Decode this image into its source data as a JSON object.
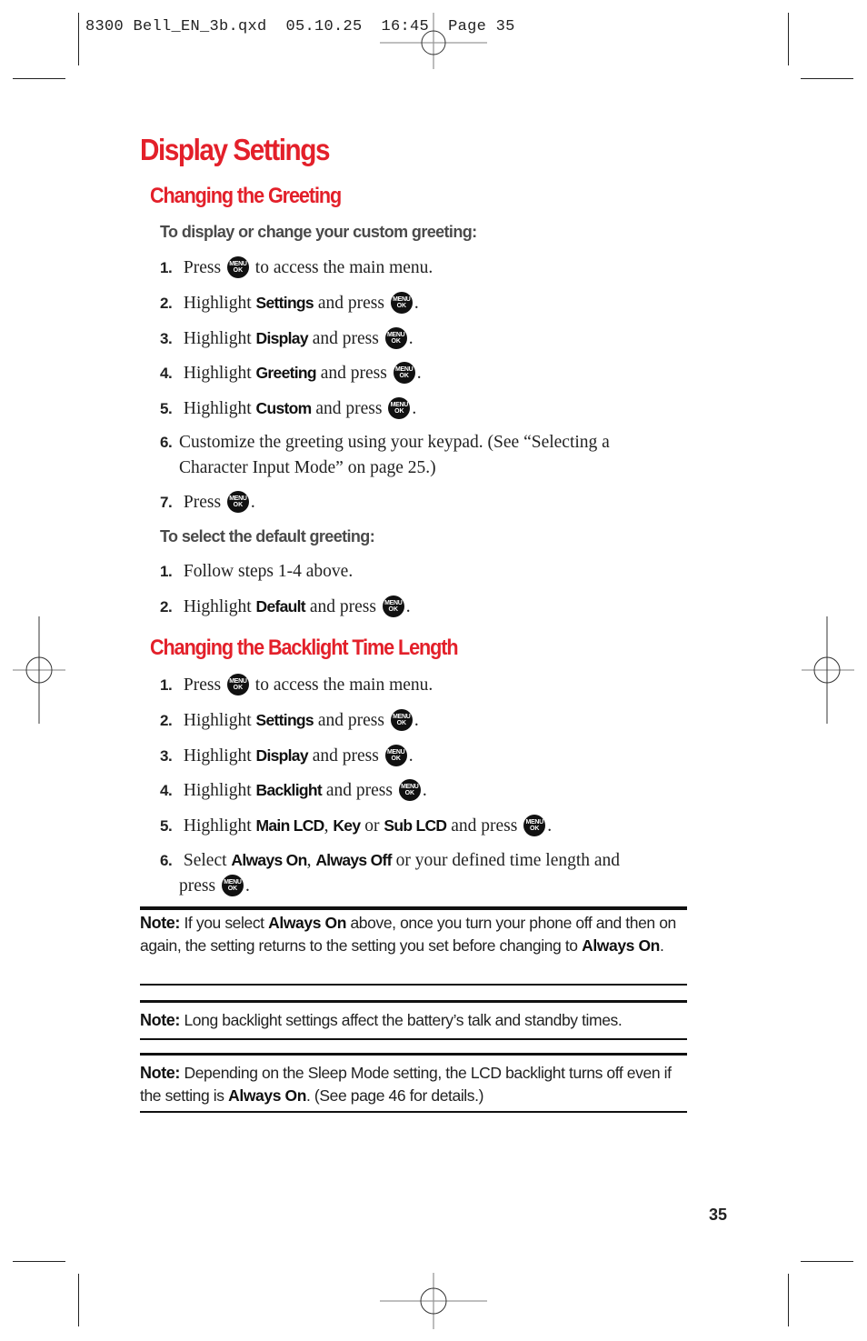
{
  "slug_line": "8300 Bell_EN_3b.qxd  05.10.25  16:45  Page 35",
  "title": "Display Settings",
  "icons": {
    "menu_ok": {
      "line1": "MENU",
      "line2": "OK",
      "name": "menu-ok-key-icon"
    }
  },
  "section1": {
    "heading": "Changing the Greeting",
    "custom": {
      "subheading": "To display or change your custom greeting:",
      "steps": [
        {
          "num": "1.",
          "pre": "Press",
          "kw": "",
          "post": "to access the main menu."
        },
        {
          "num": "2.",
          "pre": "Highlight",
          "kw": "Settings",
          "post": "and press",
          "end": "."
        },
        {
          "num": "3.",
          "pre": "Highlight",
          "kw": "Display",
          "post": "and press",
          "end": "."
        },
        {
          "num": "4.",
          "pre": "Highlight",
          "kw": "Greeting",
          "post": "and press",
          "end": "."
        },
        {
          "num": "5.",
          "pre": "Highlight",
          "kw": "Custom",
          "post": "and press",
          "end": "."
        },
        {
          "num": "6.",
          "line1": "Customize the greeting using your keypad. (See “Selecting a",
          "line2": "Character Input Mode” on page 25.)"
        },
        {
          "num": "7.",
          "pre": "Press",
          "end": "."
        }
      ]
    },
    "default": {
      "subheading": "To select the default greeting:",
      "steps": [
        {
          "num": "1.",
          "text": "Follow steps 1-4 above."
        },
        {
          "num": "2.",
          "pre": "Highlight",
          "kw": "Default",
          "post": "and press",
          "end": "."
        }
      ]
    }
  },
  "section2": {
    "heading": "Changing the Backlight Time Length",
    "steps": [
      {
        "num": "1.",
        "pre": "Press",
        "post": "to access the main menu."
      },
      {
        "num": "2.",
        "pre": "Highlight",
        "kw": "Settings",
        "post": "and press",
        "end": "."
      },
      {
        "num": "3.",
        "pre": "Highlight",
        "kw": "Display",
        "post": "and press",
        "end": "."
      },
      {
        "num": "4.",
        "pre": "Highlight",
        "kw": "Backlight",
        "post": "and press",
        "end": "."
      },
      {
        "num": "5.",
        "pre": "Highlight",
        "kw1": "Main LCD",
        "sep1": ",",
        "kw2": "Key",
        "sep2": "or",
        "kw3": "Sub LCD",
        "post": "and press",
        "end": "."
      },
      {
        "num": "6.",
        "pre": "Select",
        "kw1": "Always On",
        "sep1": ",",
        "kw2": "Always Off",
        "post": "or your defined time length and",
        "line2": "press",
        "end": "."
      }
    ]
  },
  "notes": [
    {
      "label": "Note:",
      "t1": "If you select",
      "b1": "Always On",
      "t2": "above, once you turn your phone off and then on again, the setting returns to the setting you set before changing to",
      "b2": "Always On",
      "t3": "."
    },
    {
      "label": "Note:",
      "t1": "Long backlight settings affect the battery’s talk and standby times."
    },
    {
      "label": "Note:",
      "t1": "Depending on the Sleep Mode setting, the LCD backlight turns off even if the setting is",
      "b1": "Always On",
      "t2": ". (See page 46 for details.)"
    }
  ],
  "page_number": "35"
}
